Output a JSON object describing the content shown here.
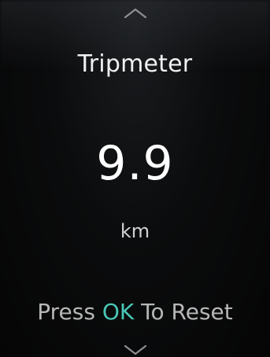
{
  "screen": {
    "title": "Tripmeter",
    "value": "9.9",
    "unit": "km",
    "hint_prefix": "Press",
    "hint_key": "OK",
    "hint_suffix": "To Reset"
  },
  "colors": {
    "background": "#050505",
    "text": "#f3f3f3",
    "accent": "#49c7b6",
    "hint_text": "#b7b7b7"
  },
  "icons": {
    "up": "chevron-up-icon",
    "down": "chevron-down-icon"
  }
}
